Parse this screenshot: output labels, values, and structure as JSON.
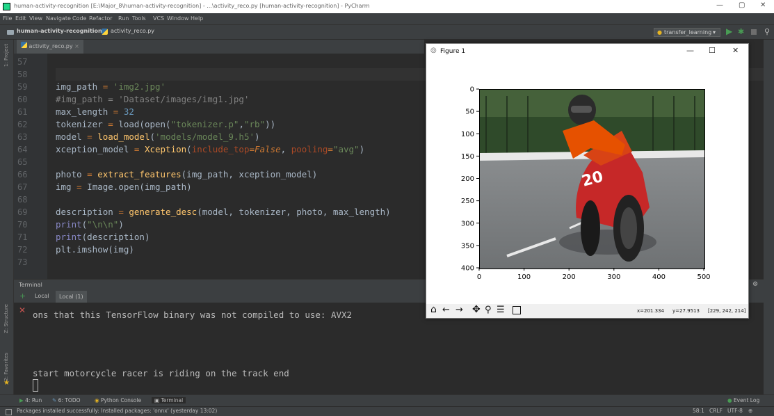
{
  "window": {
    "title": "human-activity-recognition [E:\\Major_8\\human-activity-recognition] - ...\\activity_reco.py [human-activity-recognition] - PyCharm",
    "controls": [
      "—",
      "▢",
      "✕"
    ]
  },
  "menu": [
    "File",
    "Edit",
    "View",
    "Navigate",
    "Code",
    "Refactor",
    "Run",
    "Tools",
    "VCS",
    "Window",
    "Help"
  ],
  "breadcrumb": {
    "project": "human-activity-recognition",
    "file": "activity_reco.py"
  },
  "run_config": {
    "label": "transfer_learning"
  },
  "left_tools": {
    "project": "1: Project",
    "structure": "Z: Structure",
    "favorites": "2: Favorites"
  },
  "editor": {
    "tab": "activity_reco.py",
    "lines": [
      {
        "n": "57",
        "tokens": []
      },
      {
        "n": "58",
        "tokens": []
      },
      {
        "n": "59",
        "tokens": [
          [
            "var",
            "img_path "
          ],
          [
            "op",
            "= "
          ],
          [
            "str",
            "'img2.jpg'"
          ]
        ]
      },
      {
        "n": "60",
        "tokens": [
          [
            "com",
            "#img_path = 'Dataset/images/img1.jpg'"
          ]
        ]
      },
      {
        "n": "61",
        "tokens": [
          [
            "var",
            "max_length "
          ],
          [
            "op",
            "= "
          ],
          [
            "num",
            "32"
          ]
        ]
      },
      {
        "n": "62",
        "tokens": [
          [
            "var",
            "tokenizer "
          ],
          [
            "op",
            "= "
          ],
          [
            "var",
            "load(open("
          ],
          [
            "str",
            "\"tokenizer.p\""
          ],
          [
            "var",
            ","
          ],
          [
            "str",
            "\"rb\""
          ],
          [
            "var",
            "))"
          ]
        ]
      },
      {
        "n": "63",
        "tokens": [
          [
            "var",
            "model "
          ],
          [
            "op",
            "= "
          ],
          [
            "fn",
            "load_model"
          ],
          [
            "var",
            "("
          ],
          [
            "str",
            "'models/model_9.h5'"
          ],
          [
            "var",
            ")"
          ]
        ]
      },
      {
        "n": "64",
        "tokens": [
          [
            "var",
            "xception_model "
          ],
          [
            "op",
            "= "
          ],
          [
            "cls",
            "Xception"
          ],
          [
            "var",
            "("
          ],
          [
            "kw",
            "include_top"
          ],
          [
            "op",
            "="
          ],
          [
            "kwv",
            "False"
          ],
          [
            "var",
            ", "
          ],
          [
            "kw",
            "pooling"
          ],
          [
            "op",
            "="
          ],
          [
            "str",
            "\"avg\""
          ],
          [
            "var",
            ")"
          ]
        ]
      },
      {
        "n": "65",
        "tokens": []
      },
      {
        "n": "66",
        "tokens": [
          [
            "var",
            "photo "
          ],
          [
            "op",
            "= "
          ],
          [
            "fn",
            "extract_features"
          ],
          [
            "var",
            "(img_path, xception_model)"
          ]
        ]
      },
      {
        "n": "67",
        "tokens": [
          [
            "var",
            "img "
          ],
          [
            "op",
            "= "
          ],
          [
            "var",
            "Image.open(img_path)"
          ]
        ]
      },
      {
        "n": "68",
        "tokens": []
      },
      {
        "n": "69",
        "tokens": [
          [
            "var",
            "description "
          ],
          [
            "op",
            "= "
          ],
          [
            "fn",
            "generate_desc"
          ],
          [
            "var",
            "(model, tokenizer, photo, max_length)"
          ]
        ]
      },
      {
        "n": "70",
        "tokens": [
          [
            "bi",
            "print"
          ],
          [
            "var",
            "("
          ],
          [
            "str",
            "\"\\n\\n\""
          ],
          [
            "var",
            ")"
          ]
        ]
      },
      {
        "n": "71",
        "tokens": [
          [
            "bi",
            "print"
          ],
          [
            "var",
            "(description)"
          ]
        ]
      },
      {
        "n": "72",
        "tokens": [
          [
            "var",
            "plt.imshow(img)"
          ]
        ]
      },
      {
        "n": "73",
        "tokens": []
      }
    ]
  },
  "terminal": {
    "title": "Terminal",
    "tabs": [
      "Local",
      "Local (1)"
    ],
    "lines": [
      "ons that this TensorFlow binary was not compiled to use: AVX2",
      "start motorcycle racer is riding on the track end"
    ]
  },
  "bottom_tools": [
    {
      "icon": "run-icon",
      "label": "4: Run"
    },
    {
      "icon": "todo-icon",
      "label": "6: TODO"
    },
    {
      "icon": "python-console-icon",
      "label": "Python Console"
    },
    {
      "icon": "terminal-icon",
      "label": "Terminal"
    }
  ],
  "event_log": "Event Log",
  "status": {
    "message": "Packages installed successfully: Installed packages: 'onnx' (yesterday 13:02)",
    "position": "58:1",
    "line_sep": "CRLF",
    "encoding": "UTF-8"
  },
  "figure": {
    "title": "Figure 1",
    "controls": [
      "—",
      "☐",
      "✕"
    ],
    "x_ticks": [
      "0",
      "100",
      "200",
      "300",
      "400",
      "500"
    ],
    "y_ticks": [
      "0",
      "50",
      "100",
      "150",
      "200",
      "250",
      "300",
      "350",
      "400"
    ],
    "readout": {
      "x": "x=201.334",
      "y": "y=27.9513",
      "rgb": "[229, 242, 214]"
    }
  },
  "colors": {
    "bg": "#2b2b2b",
    "panel": "#3c3f41",
    "keyword": "#cc7832",
    "string": "#6a8759",
    "comment": "#808080",
    "number": "#6897bb",
    "function": "#ffc66d"
  }
}
